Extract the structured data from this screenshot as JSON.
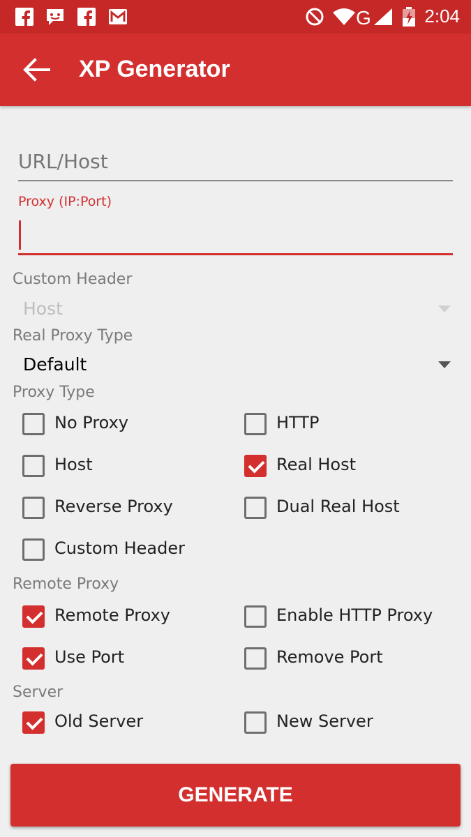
{
  "status_bar": {
    "time": "2:04",
    "left_icons": [
      "facebook-icon",
      "messenger-icon",
      "facebook-icon",
      "gmail-icon"
    ],
    "right_icons": [
      "do-not-disturb-icon",
      "wifi-icon",
      "signal-g-icon",
      "battery-icon"
    ]
  },
  "app_bar": {
    "title": "XP Generator",
    "back_icon": "back-arrow-icon"
  },
  "form": {
    "url_placeholder": "URL/Host",
    "url_value": "",
    "proxy_label": "Proxy (IP:Port)",
    "proxy_value": "",
    "custom_header": {
      "label": "Custom Header",
      "value": "Host",
      "enabled": false
    },
    "real_proxy_type": {
      "label": "Real Proxy Type",
      "value": "Default"
    },
    "proxy_type": {
      "label": "Proxy Type",
      "options": [
        {
          "label": "No Proxy",
          "checked": false
        },
        {
          "label": "HTTP",
          "checked": false
        },
        {
          "label": "Host",
          "checked": false
        },
        {
          "label": "Real Host",
          "checked": true
        },
        {
          "label": "Reverse Proxy",
          "checked": false
        },
        {
          "label": "Dual Real Host",
          "checked": false
        },
        {
          "label": "Custom Header",
          "checked": false
        }
      ]
    },
    "remote_proxy": {
      "label": "Remote Proxy",
      "options": [
        {
          "label": "Remote Proxy",
          "checked": true
        },
        {
          "label": "Enable HTTP Proxy",
          "checked": false
        },
        {
          "label": "Use Port",
          "checked": true
        },
        {
          "label": "Remove Port",
          "checked": false
        }
      ]
    },
    "server": {
      "label": "Server",
      "options": [
        {
          "label": "Old Server",
          "checked": true
        },
        {
          "label": "New Server",
          "checked": false
        }
      ]
    }
  },
  "generate_label": "GENERATE",
  "colors": {
    "accent": "#d32f2f",
    "status_bar": "#c62828",
    "background": "#efefef"
  }
}
